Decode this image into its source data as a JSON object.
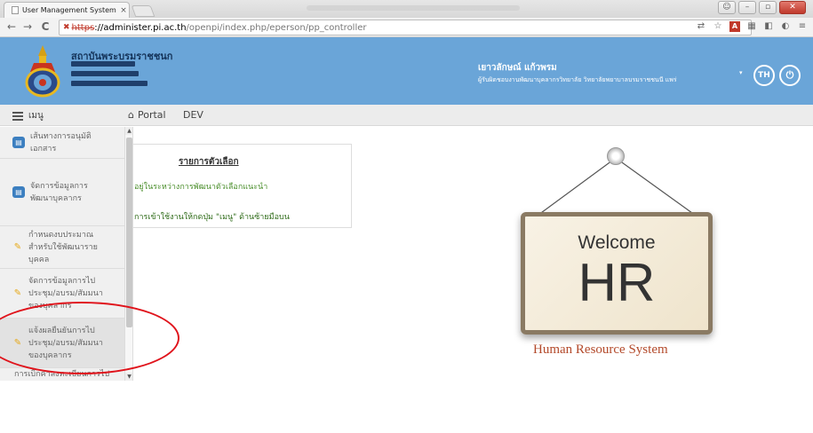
{
  "browser": {
    "tab_title": "User Management System",
    "tab_close": "×",
    "url_scheme": "https",
    "url_host": "://administer.pi.ac.th",
    "url_path": "/openpi/index.php/eperson/pp_controller",
    "back_icon": "←",
    "forward_icon": "→",
    "reload_icon": "C"
  },
  "header": {
    "org_line1": "สถาบันพระบรมราชชนก",
    "user_name": "เยาวลักษณ์ แก้วพรม",
    "user_role": "ผู้รับผิดชอบงานพัฒนาบุคลากรวิทยาลัย วิทยาลัยพยาบาลบรมราชชนนี แพร่",
    "lang_button": "TH",
    "caret": "▾"
  },
  "menubar": {
    "menu_label": "เมนู",
    "portal_label": "Portal",
    "dev_label": "DEV"
  },
  "sidebar": {
    "items": [
      {
        "label": "เส้นทางการอนุมัติ\nเอกสาร",
        "icon": "book-icon"
      },
      {
        "label": "จัดการข้อมูลการ\nพัฒนาบุคลากร",
        "icon": "book-icon"
      },
      {
        "label": "กำหนดงบประมาณ\nสำหรับใช้พัฒนาราย\nบุคคล",
        "icon": "pencil-icon"
      },
      {
        "label": "จัดการข้อมูลการไป\nประชุม/อบรม/สัมมนา\nของบุคลากร",
        "icon": "pencil-icon"
      },
      {
        "label": "แจ้งผลยืนยันการไป\nประชุม/อบรม/สัมมนา\nของบุคลากร",
        "icon": "pencil-icon"
      },
      {
        "label": "การเบิกค่าลงทะเบียนการไป",
        "icon": "pencil-icon"
      }
    ]
  },
  "options": {
    "title": "รายการตัวเลือก",
    "line1": "อยู่ในระหว่างการพัฒนาตัวเลือกแนะนำ",
    "line2": "การเข้าใช้งานให้กดปุ่ม \"เมนู\" ด้านซ้ายมือบน"
  },
  "welcome": {
    "word": "Welcome",
    "big": "HR",
    "system": "Human Resource System"
  },
  "colors": {
    "header_bg": "#6aa5d8",
    "annotation": "#e0141c",
    "system_text": "#b34a2b"
  }
}
